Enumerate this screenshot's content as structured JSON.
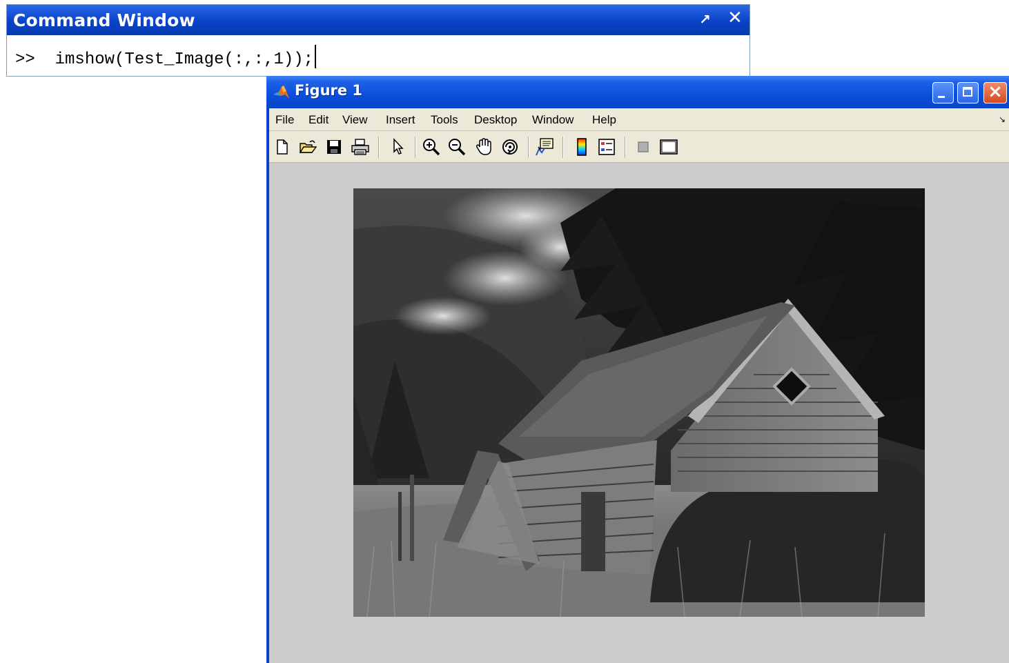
{
  "command_window": {
    "title": "Command Window",
    "undock_symbol": "↗",
    "close_symbol": "✕",
    "prompt": ">>",
    "command": "imshow(Test_Image(:,:,1));"
  },
  "figure": {
    "title": "Figure 1",
    "menu": [
      "File",
      "Edit",
      "View",
      "Insert",
      "Tools",
      "Desktop",
      "Window",
      "Help"
    ],
    "toolbar_icons": [
      "new-figure-icon",
      "open-file-icon",
      "save-icon",
      "print-icon",
      "select-arrow-icon",
      "zoom-in-icon",
      "zoom-out-icon",
      "pan-hand-icon",
      "rotate-3d-icon",
      "data-cursor-icon",
      "insert-colorbar-icon",
      "insert-legend-icon",
      "hide-plot-tools-icon",
      "show-plot-tools-icon"
    ],
    "image_description": "grayscale photo of a collapsing wooden shack in front of a forested hillside with mist"
  },
  "colors": {
    "titlebar_blue": "#0a4ed9",
    "figure_background": "#cccccc",
    "menubar_background": "#ece9d8"
  }
}
